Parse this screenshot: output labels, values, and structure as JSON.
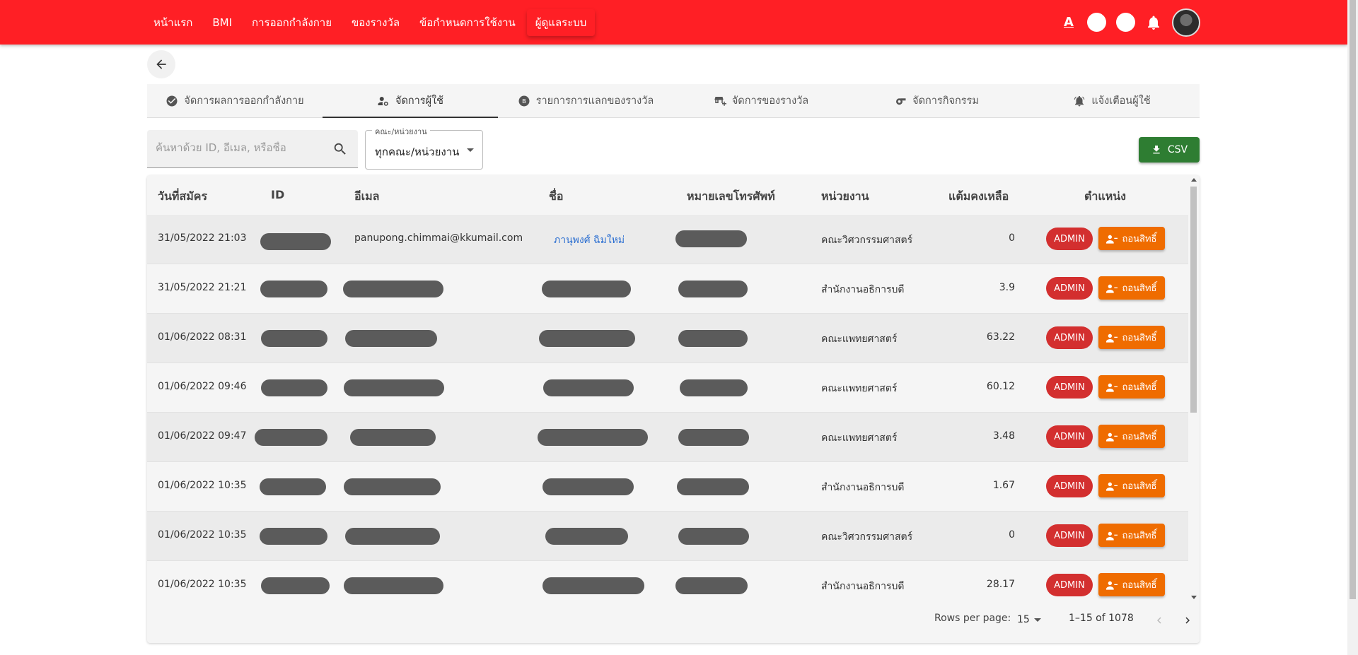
{
  "nav": {
    "items": [
      {
        "label": "หน้าแรก",
        "active": false
      },
      {
        "label": "BMI",
        "active": false
      },
      {
        "label": "การออกกำลังกาย",
        "active": false
      },
      {
        "label": "ของรางวัล",
        "active": false
      },
      {
        "label": "ข้อกำหนดการใช้งาน",
        "active": false
      },
      {
        "label": "ผู้ดูแลระบบ",
        "active": true
      }
    ],
    "font_icon_label": "A"
  },
  "tabs": [
    {
      "label": "จัดการผลการออกกำลังกาย",
      "icon": "check-circle-icon",
      "active": false
    },
    {
      "label": "จัดการผู้ใช้",
      "icon": "manage-accounts-icon",
      "active": true
    },
    {
      "label": "รายการการแลกของรางวัล",
      "icon": "redeem-list-icon",
      "active": false
    },
    {
      "label": "จัดการของรางวัล",
      "icon": "add-business-icon",
      "active": false
    },
    {
      "label": "จัดการกิจกรรม",
      "icon": "whistle-icon",
      "active": false
    },
    {
      "label": "แจ้งเตือนผู้ใช้",
      "icon": "alarm-bell-icon",
      "active": false
    }
  ],
  "filters": {
    "search_placeholder": "ค้นหาด้วย ID, อีเมล, หรือชื่อ",
    "search_value": "",
    "dept_label": "คณะ/หน่วยงาน",
    "dept_value": "ทุกคณะ/หน่วยงาน",
    "csv_label": "CSV"
  },
  "table": {
    "headers": {
      "date": "วันที่สมัคร",
      "id": "ID",
      "email": "อีเมล",
      "name": "ชื่อ",
      "phone": "หมายเลขโทรศัพท์",
      "dept": "หน่วยงาน",
      "points": "แต้มคงเหลือ",
      "role": "ตำแหน่ง"
    },
    "rows": [
      {
        "date": "31/05/2022 21:03",
        "email": "panupong.chimmai@kkumail.com",
        "name": "ภานุพงศ์ ฉิมใหม่",
        "dept": "คณะวิศวกรรมศาสตร์",
        "points": "0",
        "role": "ADMIN",
        "action": "ถอนสิทธิ์"
      },
      {
        "date": "31/05/2022 21:21",
        "email": "",
        "name": "",
        "dept": "สำนักงานอธิการบดี",
        "points": "3.9",
        "role": "ADMIN",
        "action": "ถอนสิทธิ์"
      },
      {
        "date": "01/06/2022 08:31",
        "email": "",
        "name": "",
        "dept": "คณะแพทยศาสตร์",
        "points": "63.22",
        "role": "ADMIN",
        "action": "ถอนสิทธิ์"
      },
      {
        "date": "01/06/2022 09:46",
        "email": "",
        "name": "",
        "dept": "คณะแพทยศาสตร์",
        "points": "60.12",
        "role": "ADMIN",
        "action": "ถอนสิทธิ์"
      },
      {
        "date": "01/06/2022 09:47",
        "email": "",
        "name": "",
        "dept": "คณะแพทยศาสตร์",
        "points": "3.48",
        "role": "ADMIN",
        "action": "ถอนสิทธิ์"
      },
      {
        "date": "01/06/2022 10:35",
        "email": "",
        "name": "",
        "dept": "สำนักงานอธิการบดี",
        "points": "1.67",
        "role": "ADMIN",
        "action": "ถอนสิทธิ์"
      },
      {
        "date": "01/06/2022 10:35",
        "email": "",
        "name": "",
        "dept": "คณะวิศวกรรมศาสตร์",
        "points": "0",
        "role": "ADMIN",
        "action": "ถอนสิทธิ์"
      },
      {
        "date": "01/06/2022 10:35",
        "email": "",
        "name": "",
        "dept": "สำนักงานอธิการบดี",
        "points": "28.17",
        "role": "ADMIN",
        "action": "ถอนสิทธิ์"
      }
    ]
  },
  "pagination": {
    "rows_per_page_label": "Rows per page:",
    "rows_per_page": "15",
    "range": "1–15 of 1078"
  },
  "colors": {
    "appbar": "#ff1f25",
    "admin_chip": "#d32f2f",
    "revoke_button": "#ef6c00",
    "csv_button": "#2e7d32",
    "name_link": "#2c6fd1"
  }
}
